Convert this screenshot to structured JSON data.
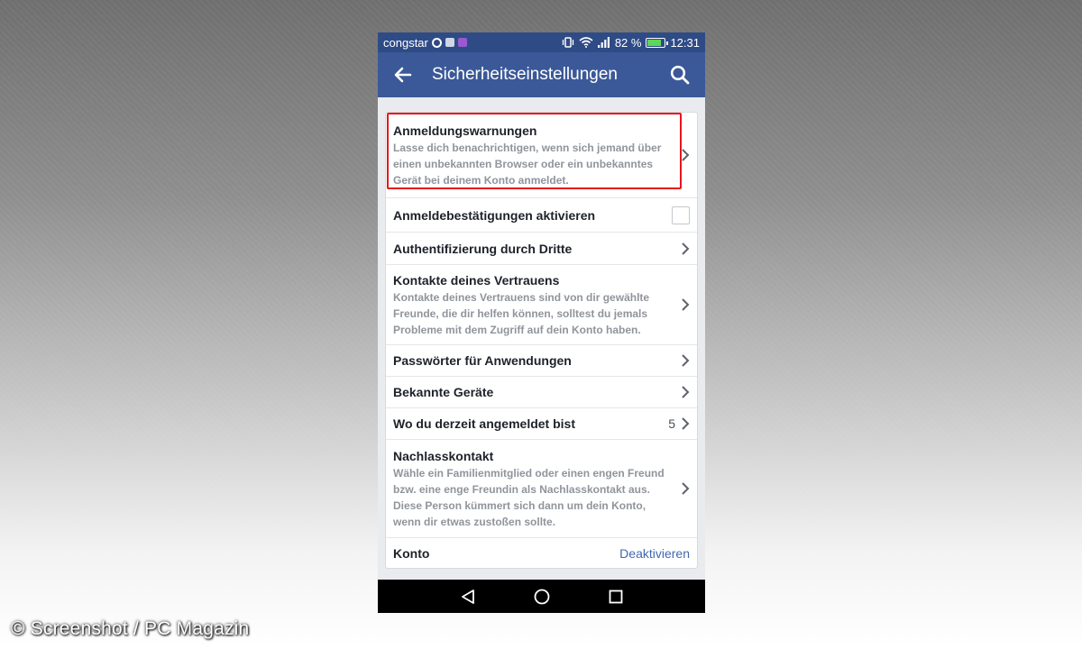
{
  "status_bar": {
    "carrier": "congstar",
    "battery_percent": "82 %",
    "battery_level": 0.82,
    "time": "12:31"
  },
  "app_bar": {
    "title": "Sicherheitseinstellungen",
    "back_icon": "arrow-left-icon",
    "search_icon": "search-icon"
  },
  "settings": [
    {
      "title": "Anmeldungswarnungen",
      "description": "Lasse dich benachrichtigen, wenn sich jemand über einen unbekannten Browser oder ein unbekanntes Gerät bei deinem Konto anmeldet.",
      "highlighted": true
    },
    {
      "title": "Anmeldebestätigungen aktivieren",
      "checked": false
    },
    {
      "title": "Authentifizierung durch Dritte"
    },
    {
      "title": "Kontakte deines Vertrauens",
      "description": "Kontakte deines Vertrauens sind von dir gewählte Freunde, die dir helfen können, solltest du jemals Probleme mit dem Zugriff auf dein Konto haben."
    },
    {
      "title": "Passwörter für Anwendungen"
    },
    {
      "title": "Bekannte Geräte"
    },
    {
      "title": "Wo du derzeit angemeldet bist",
      "count": "5"
    },
    {
      "title": "Nachlasskontakt",
      "description": "Wähle ein Familienmitglied oder einen engen Freund bzw. eine enge Freundin als Nachlasskontakt aus. Diese Person kümmert sich dann um dein Konto, wenn dir etwas zustoßen sollte."
    },
    {
      "title": "Konto",
      "action": "Deaktivieren"
    }
  ],
  "colors": {
    "app_bar": "#3b5998",
    "status_bar": "#2f4b86",
    "highlight": "#e8141c",
    "link": "#4267b2"
  },
  "watermark": "© Screenshot / PC Magazin"
}
